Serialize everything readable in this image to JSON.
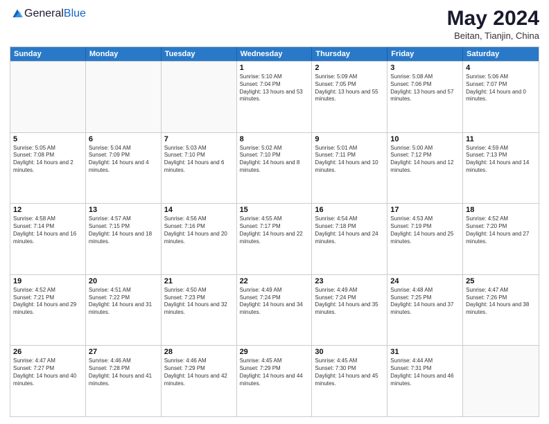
{
  "header": {
    "logo_general": "General",
    "logo_blue": "Blue",
    "title": "May 2024",
    "subtitle": "Beitan, Tianjin, China"
  },
  "days_of_week": [
    "Sunday",
    "Monday",
    "Tuesday",
    "Wednesday",
    "Thursday",
    "Friday",
    "Saturday"
  ],
  "weeks": [
    [
      {
        "day": "",
        "empty": true
      },
      {
        "day": "",
        "empty": true
      },
      {
        "day": "",
        "empty": true
      },
      {
        "day": "1",
        "sunrise": "5:10 AM",
        "sunset": "7:04 PM",
        "daylight": "13 hours and 53 minutes."
      },
      {
        "day": "2",
        "sunrise": "5:09 AM",
        "sunset": "7:05 PM",
        "daylight": "13 hours and 55 minutes."
      },
      {
        "day": "3",
        "sunrise": "5:08 AM",
        "sunset": "7:06 PM",
        "daylight": "13 hours and 57 minutes."
      },
      {
        "day": "4",
        "sunrise": "5:06 AM",
        "sunset": "7:07 PM",
        "daylight": "14 hours and 0 minutes."
      }
    ],
    [
      {
        "day": "5",
        "sunrise": "5:05 AM",
        "sunset": "7:08 PM",
        "daylight": "14 hours and 2 minutes."
      },
      {
        "day": "6",
        "sunrise": "5:04 AM",
        "sunset": "7:09 PM",
        "daylight": "14 hours and 4 minutes."
      },
      {
        "day": "7",
        "sunrise": "5:03 AM",
        "sunset": "7:10 PM",
        "daylight": "14 hours and 6 minutes."
      },
      {
        "day": "8",
        "sunrise": "5:02 AM",
        "sunset": "7:10 PM",
        "daylight": "14 hours and 8 minutes."
      },
      {
        "day": "9",
        "sunrise": "5:01 AM",
        "sunset": "7:11 PM",
        "daylight": "14 hours and 10 minutes."
      },
      {
        "day": "10",
        "sunrise": "5:00 AM",
        "sunset": "7:12 PM",
        "daylight": "14 hours and 12 minutes."
      },
      {
        "day": "11",
        "sunrise": "4:59 AM",
        "sunset": "7:13 PM",
        "daylight": "14 hours and 14 minutes."
      }
    ],
    [
      {
        "day": "12",
        "sunrise": "4:58 AM",
        "sunset": "7:14 PM",
        "daylight": "14 hours and 16 minutes."
      },
      {
        "day": "13",
        "sunrise": "4:57 AM",
        "sunset": "7:15 PM",
        "daylight": "14 hours and 18 minutes."
      },
      {
        "day": "14",
        "sunrise": "4:56 AM",
        "sunset": "7:16 PM",
        "daylight": "14 hours and 20 minutes."
      },
      {
        "day": "15",
        "sunrise": "4:55 AM",
        "sunset": "7:17 PM",
        "daylight": "14 hours and 22 minutes."
      },
      {
        "day": "16",
        "sunrise": "4:54 AM",
        "sunset": "7:18 PM",
        "daylight": "14 hours and 24 minutes."
      },
      {
        "day": "17",
        "sunrise": "4:53 AM",
        "sunset": "7:19 PM",
        "daylight": "14 hours and 25 minutes."
      },
      {
        "day": "18",
        "sunrise": "4:52 AM",
        "sunset": "7:20 PM",
        "daylight": "14 hours and 27 minutes."
      }
    ],
    [
      {
        "day": "19",
        "sunrise": "4:52 AM",
        "sunset": "7:21 PM",
        "daylight": "14 hours and 29 minutes."
      },
      {
        "day": "20",
        "sunrise": "4:51 AM",
        "sunset": "7:22 PM",
        "daylight": "14 hours and 31 minutes."
      },
      {
        "day": "21",
        "sunrise": "4:50 AM",
        "sunset": "7:23 PM",
        "daylight": "14 hours and 32 minutes."
      },
      {
        "day": "22",
        "sunrise": "4:49 AM",
        "sunset": "7:24 PM",
        "daylight": "14 hours and 34 minutes."
      },
      {
        "day": "23",
        "sunrise": "4:49 AM",
        "sunset": "7:24 PM",
        "daylight": "14 hours and 35 minutes."
      },
      {
        "day": "24",
        "sunrise": "4:48 AM",
        "sunset": "7:25 PM",
        "daylight": "14 hours and 37 minutes."
      },
      {
        "day": "25",
        "sunrise": "4:47 AM",
        "sunset": "7:26 PM",
        "daylight": "14 hours and 38 minutes."
      }
    ],
    [
      {
        "day": "26",
        "sunrise": "4:47 AM",
        "sunset": "7:27 PM",
        "daylight": "14 hours and 40 minutes."
      },
      {
        "day": "27",
        "sunrise": "4:46 AM",
        "sunset": "7:28 PM",
        "daylight": "14 hours and 41 minutes."
      },
      {
        "day": "28",
        "sunrise": "4:46 AM",
        "sunset": "7:29 PM",
        "daylight": "14 hours and 42 minutes."
      },
      {
        "day": "29",
        "sunrise": "4:45 AM",
        "sunset": "7:29 PM",
        "daylight": "14 hours and 44 minutes."
      },
      {
        "day": "30",
        "sunrise": "4:45 AM",
        "sunset": "7:30 PM",
        "daylight": "14 hours and 45 minutes."
      },
      {
        "day": "31",
        "sunrise": "4:44 AM",
        "sunset": "7:31 PM",
        "daylight": "14 hours and 46 minutes."
      },
      {
        "day": "",
        "empty": true
      }
    ]
  ]
}
